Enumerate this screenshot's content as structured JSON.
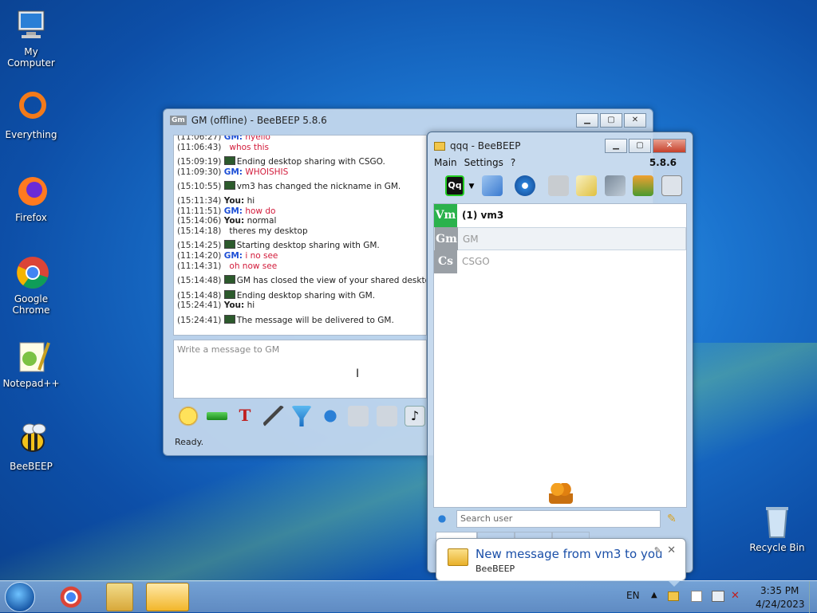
{
  "desktop_icons": [
    {
      "label": "My Computer",
      "icon": "computer-icon"
    },
    {
      "label": "Everything",
      "icon": "everything-icon"
    },
    {
      "label": "Firefox",
      "icon": "firefox-icon"
    },
    {
      "label": "Google Chrome",
      "icon": "chrome-icon"
    },
    {
      "label": "Notepad++",
      "icon": "notepad-plus-icon"
    },
    {
      "label": "BeeBEEP",
      "icon": "bee-icon"
    },
    {
      "label": "Recycle Bin",
      "icon": "recycle-bin-icon"
    }
  ],
  "chat": {
    "title": "GM (offline) - BeeBEEP 5.8.6",
    "badge": "Gm",
    "lines": [
      {
        "ts": "(11:06:27)",
        "who": "GM:",
        "cls": "gm",
        "text": "hyello",
        "tcls": "red"
      },
      {
        "ts": "(11:06:43)",
        "who": "",
        "cls": "",
        "text": "whos this",
        "tcls": "red"
      },
      {
        "ts": "(15:09:19)",
        "who": "",
        "cls": "",
        "text": "Ending desktop sharing with CSGO.",
        "tcls": "",
        "icon": true
      },
      {
        "ts": "(11:09:30)",
        "who": "GM:",
        "cls": "gm",
        "text": "WHOISHIS",
        "tcls": "red"
      },
      {
        "ts": "(15:10:55)",
        "who": "",
        "cls": "",
        "text": "vm3 has changed the nickname in GM.",
        "tcls": "",
        "icon": true
      },
      {
        "ts": "(15:11:34)",
        "who": "You:",
        "cls": "you",
        "text": "hi",
        "tcls": ""
      },
      {
        "ts": "(11:11:51)",
        "who": "GM:",
        "cls": "gm",
        "text": "how do",
        "tcls": "red"
      },
      {
        "ts": "(15:14:06)",
        "who": "You:",
        "cls": "you",
        "text": "normal",
        "tcls": ""
      },
      {
        "ts": "(15:14:18)",
        "who": "",
        "cls": "",
        "text": "theres my desktop",
        "tcls": ""
      },
      {
        "ts": "(15:14:25)",
        "who": "",
        "cls": "",
        "text": "Starting desktop sharing with GM.",
        "tcls": "",
        "icon": true
      },
      {
        "ts": "(11:14:20)",
        "who": "GM:",
        "cls": "gm",
        "text": "i no see",
        "tcls": "red"
      },
      {
        "ts": "(11:14:31)",
        "who": "",
        "cls": "",
        "text": "oh now see",
        "tcls": "red"
      },
      {
        "ts": "(15:14:48)",
        "who": "",
        "cls": "",
        "text": "GM has closed the view of your shared desktop.",
        "tcls": "",
        "icon": true
      },
      {
        "ts": "(15:14:48)",
        "who": "",
        "cls": "",
        "text": "Ending desktop sharing with GM.",
        "tcls": "",
        "icon": true
      },
      {
        "ts": "(15:24:41)",
        "who": "You:",
        "cls": "you",
        "text": "hi",
        "tcls": ""
      },
      {
        "ts": "(15:24:41)",
        "who": "",
        "cls": "",
        "text": "The message will be delivered to GM.",
        "tcls": "",
        "icon": true
      }
    ],
    "placeholder": "Write a message to GM",
    "status": "Ready."
  },
  "main": {
    "title": "qqq - BeeBEEP",
    "menu": [
      "Main",
      "Settings",
      "?"
    ],
    "version": "5.8.6",
    "search_placeholder": "Search user",
    "users": [
      {
        "av": "Vm",
        "name": "(1) vm3",
        "color": "#2bb24c",
        "bold": true
      },
      {
        "av": "Gm",
        "name": "GM",
        "color": "#9aa0a6",
        "bold": false
      },
      {
        "av": "Cs",
        "name": "CSGO",
        "color": "#9aa0a6",
        "bold": false
      }
    ]
  },
  "notify": {
    "title": "New message from vm3 to you",
    "app": "BeeBEEP"
  },
  "tray": {
    "lang": "EN",
    "time": "3:35 PM",
    "date": "4/24/2023"
  }
}
